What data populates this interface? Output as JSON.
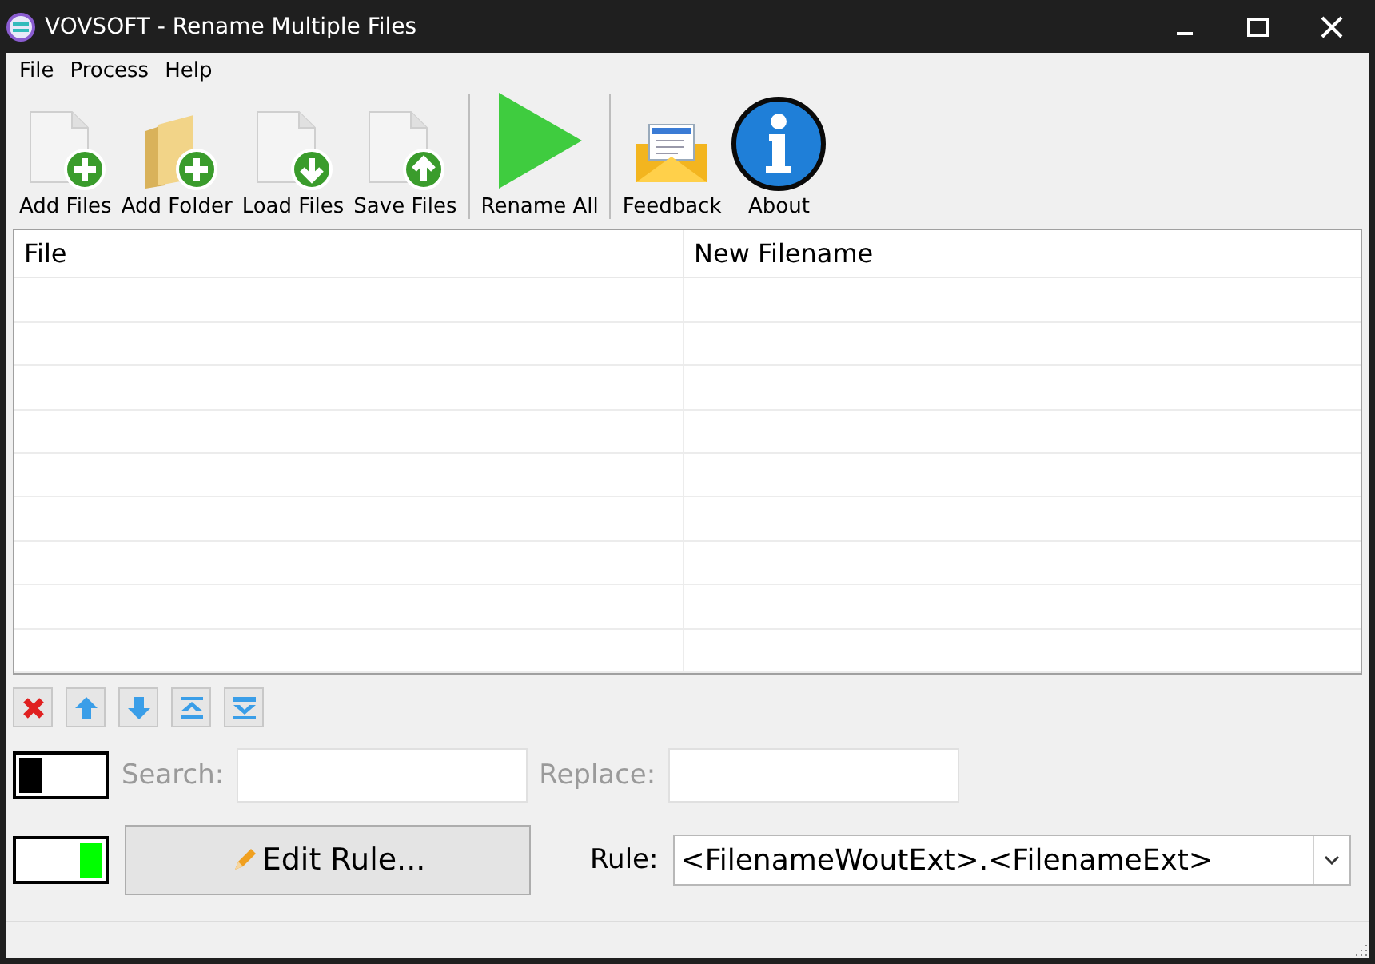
{
  "window": {
    "title": "VOVSOFT - Rename Multiple Files"
  },
  "menu": [
    "File",
    "Process",
    "Help"
  ],
  "toolbar_groups": [
    [
      {
        "label": "Add Files",
        "kind": "addfile"
      },
      {
        "label": "Add Folder",
        "kind": "addfolder"
      },
      {
        "label": "Load Files",
        "kind": "load"
      },
      {
        "label": "Save Files",
        "kind": "save"
      }
    ],
    [
      {
        "label": "Rename All",
        "kind": "run"
      }
    ],
    [
      {
        "label": "Feedback",
        "kind": "mail"
      },
      {
        "label": "About",
        "kind": "info"
      }
    ]
  ],
  "table": {
    "columns": [
      "File",
      "New Filename"
    ]
  },
  "search_row": {
    "toggle_on": false,
    "search_label": "Search:",
    "replace_label": "Replace:",
    "disabled": true
  },
  "rule_row": {
    "toggle_on": true,
    "edit_button": "Edit Rule...",
    "rule_label": "Rule:",
    "rule_value": "<FilenameWoutExt>.<FilenameExt>"
  }
}
